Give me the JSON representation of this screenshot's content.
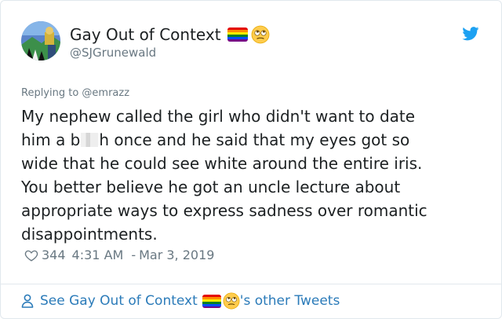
{
  "tweet": {
    "display_name": "Gay Out of Context",
    "handle": "@SJGrunewald",
    "replying_to": "Replying to @emrazz",
    "body": {
      "line1": "My nephew called the girl who didn't want to date",
      "line2_pre": "him a b",
      "line2_post": "h once and he said that my eyes got so",
      "line3": "wide that he could see white around the entire iris.",
      "line4": "You better believe he got an uncle lecture about",
      "line5": "appropriate ways to express sadness over romantic",
      "line6": "disappointments."
    },
    "likes": "344",
    "time": "4:31 AM",
    "date_sep": "-",
    "date": "Mar 3, 2019"
  },
  "footer": {
    "prefix": "See Gay Out of Context",
    "suffix": "'s other Tweets"
  },
  "icons": {
    "header_emoji": "rolling-eyes-emoji",
    "footer_emoji": "rolling-eyes-emoji",
    "like": "heart-outline",
    "brand": "twitter-bird",
    "profile": "person-outline"
  },
  "colors": {
    "link": "#2b7bb9",
    "muted": "#697882",
    "text": "#1c2022",
    "twitter_blue": "#1da1f2"
  }
}
